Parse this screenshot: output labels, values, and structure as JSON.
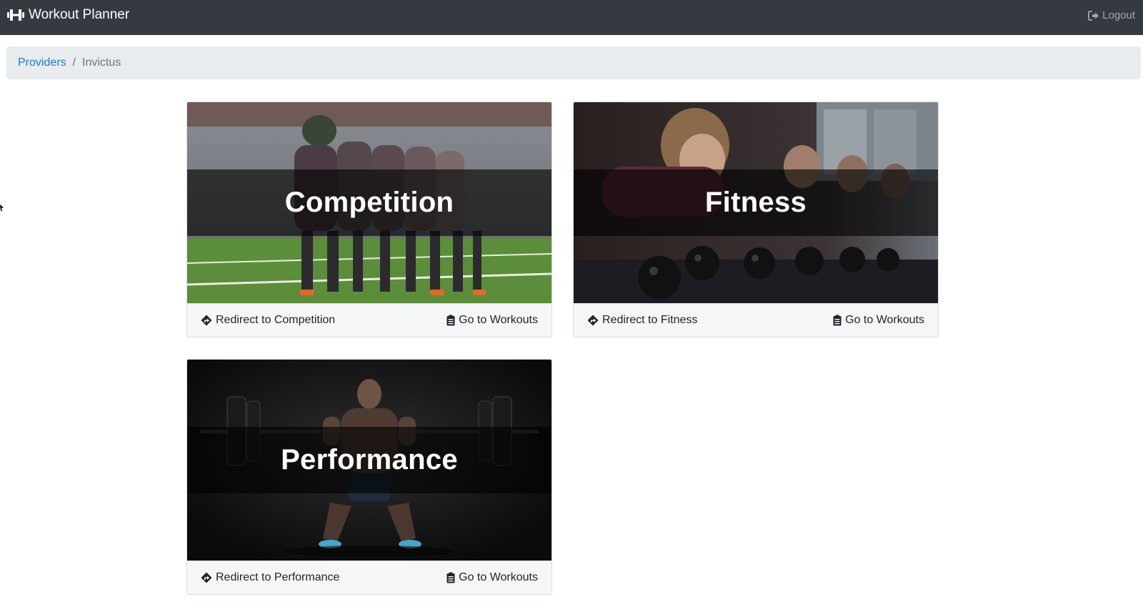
{
  "navbar": {
    "brand_icon": "dumbbell-icon",
    "brand": "Workout Planner",
    "logout_icon": "sign-out-icon",
    "logout": "Logout",
    "background": "#343a40"
  },
  "breadcrumb": {
    "items": [
      {
        "label": "Providers",
        "link": true
      },
      {
        "label": "Invictus",
        "link": false
      }
    ],
    "separator": "/"
  },
  "cards": [
    {
      "title": "Competition",
      "redirect_label": "Redirect to Competition",
      "redirect_icon": "directions-icon",
      "workouts_label": "Go to Workouts",
      "workouts_icon": "clipboard-icon"
    },
    {
      "title": "Fitness",
      "redirect_label": "Redirect to Fitness",
      "redirect_icon": "directions-icon",
      "workouts_label": "Go to Workouts",
      "workouts_icon": "clipboard-icon"
    },
    {
      "title": "Performance",
      "redirect_label": "Redirect to Performance",
      "redirect_icon": "directions-icon",
      "workouts_label": "Go to Workouts",
      "workouts_icon": "clipboard-icon"
    }
  ],
  "colors": {
    "link": "#1f7ae0",
    "breadcrumb_bg": "#e9ecef",
    "footer_bg": "#f5f6f7"
  }
}
